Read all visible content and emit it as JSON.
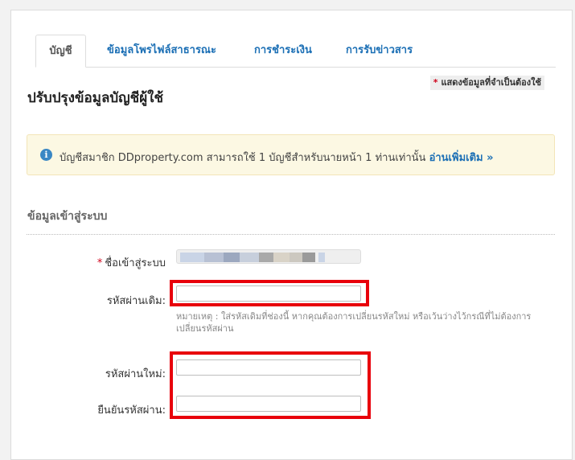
{
  "tabs": [
    {
      "label": "บัญชี",
      "active": true
    },
    {
      "label": "ข้อมูลโพรไฟล์สาธารณะ",
      "active": false
    },
    {
      "label": "การชำระเงิน",
      "active": false
    },
    {
      "label": "การรับข่าวสาร",
      "active": false
    }
  ],
  "required_note": {
    "star": "*",
    "text": "แสดงข้อมูลที่จำเป็นต้องใช้"
  },
  "page_title": "ปรับปรุงข้อมูลบัญชีผู้ใช้",
  "alert": {
    "icon": "i",
    "message": "บัญชีสมาชิก DDproperty.com สามารถใช้ 1 บัญชีสำหรับนายหน้า 1 ท่านเท่านั้น",
    "link_label": "อ่านเพิ่มเติม »"
  },
  "section_title": "ข้อมูลเข้าสู่ระบบ",
  "form": {
    "username_label": "ชื่อเข้าสู่ระบบ",
    "username_star": "*",
    "current_password_label": "รหัสผ่านเดิม:",
    "hint": "หมายเหตุ : ใส่รหัสเดิมที่ช่องนี้ หากคุณต้องการเปลี่ยนรหัสใหม่ หรือเว้นว่างไว้กรณีที่ไม่ต้องการเปลี่ยนรหัสผ่าน",
    "new_password_label": "รหัสผ่านใหม่:",
    "confirm_password_label": "ยืนยันรหัสผ่าน:"
  },
  "colors": {
    "link": "#1b6fb5",
    "highlight_box": "#e8000b",
    "alert_bg": "#fcf8e3",
    "required_star": "#d0021b"
  }
}
